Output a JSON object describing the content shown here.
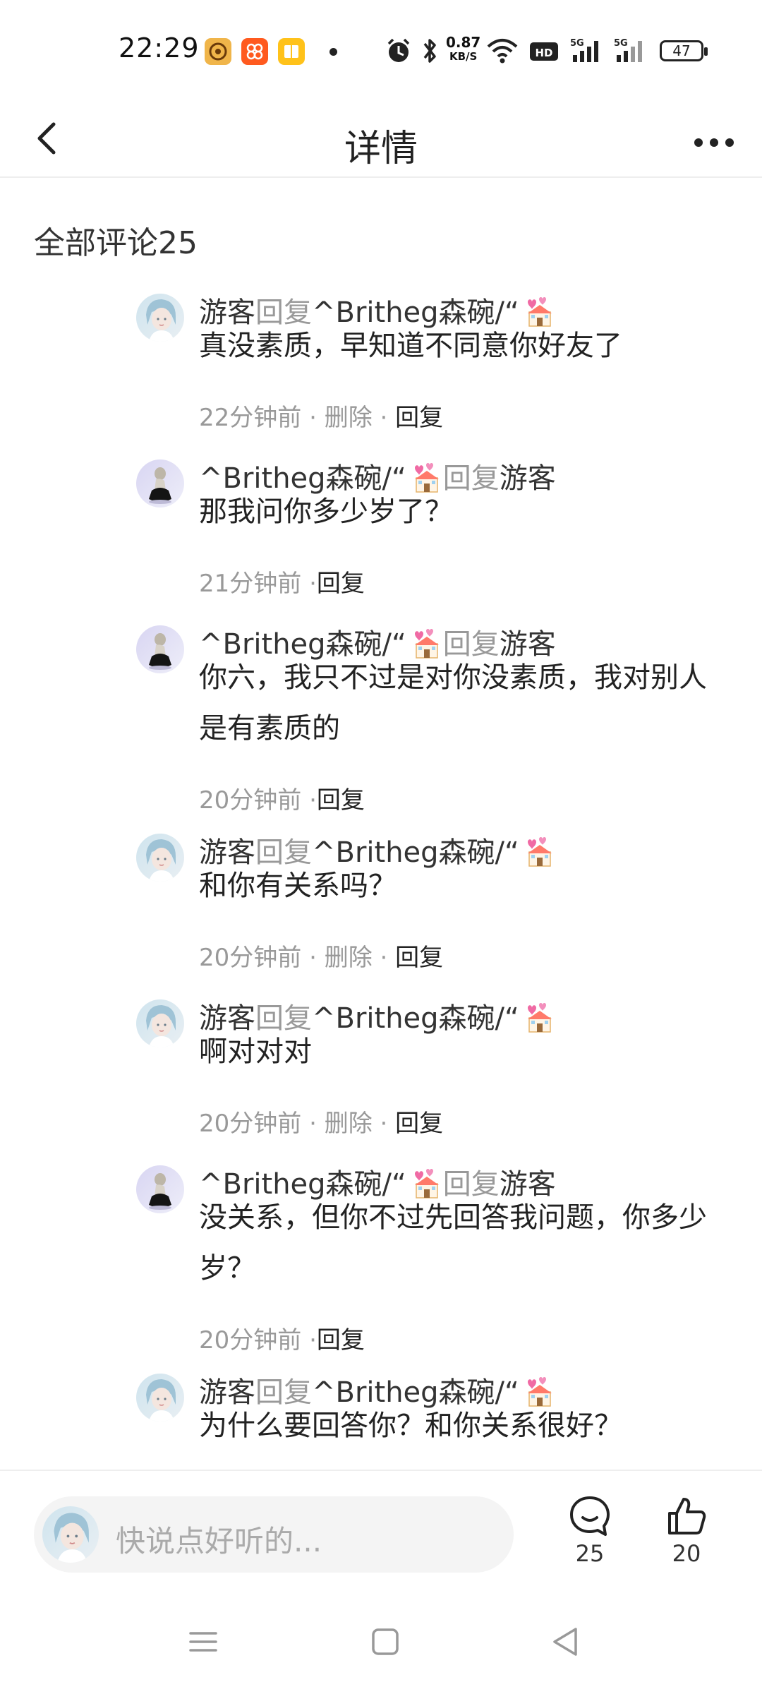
{
  "status_bar": {
    "time": "22:29",
    "net_speed_value": "0.87",
    "net_speed_unit": "KB/S",
    "battery": "47",
    "icons": [
      "app-icon-1",
      "app-icon-2",
      "app-icon-3",
      "alarm-icon",
      "bluetooth-icon",
      "wifi-icon",
      "hd-icon",
      "signal-5g-icon",
      "signal-5g-icon"
    ]
  },
  "header": {
    "title": "详情",
    "back_icon": "chevron-left-icon",
    "more_icon": "more-dots-icon"
  },
  "comments_section": {
    "title": "全部评论25"
  },
  "comments": [
    {
      "author": "游客",
      "reply_word": "回复",
      "target": "^Britheg森碗/“",
      "text": "真没素质，早知道不同意你好友了",
      "time": "22分钟前",
      "sep1": " · ",
      "delete": "删除",
      "sep2": " · ",
      "reply": "回复"
    },
    {
      "author": "^Britheg森碗/“",
      "reply_word": "回复",
      "target": "游客",
      "text": "那我问你多少岁了？",
      "time": "21分钟前",
      "sep2": " ·",
      "reply": "回复"
    },
    {
      "author": "^Britheg森碗/“",
      "reply_word": "回复",
      "target": "游客",
      "text": "你六，我只不过是对你没素质，我对别人是有素质的",
      "time": "20分钟前",
      "sep2": " ·",
      "reply": "回复"
    },
    {
      "author": "游客",
      "reply_word": "回复",
      "target": "^Britheg森碗/“",
      "text": "和你有关系吗？",
      "time": "20分钟前",
      "sep1": " · ",
      "delete": "删除",
      "sep2": " · ",
      "reply": "回复"
    },
    {
      "author": "游客",
      "reply_word": "回复",
      "target": "^Britheg森碗/“",
      "text": "啊对对对",
      "time": "20分钟前",
      "sep1": " · ",
      "delete": "删除",
      "sep2": " · ",
      "reply": "回复"
    },
    {
      "author": "^Britheg森碗/“",
      "reply_word": "回复",
      "target": "游客",
      "text": "没关系，但你不过先回答我问题，你多少岁？",
      "time": "20分钟前",
      "sep2": " ·",
      "reply": "回复"
    },
    {
      "author": "游客",
      "reply_word": "回复",
      "target": "^Britheg森碗/“",
      "text": "为什么要回答你？和你关系很好？"
    }
  ],
  "bottom_bar": {
    "input_placeholder": "快说点好听的...",
    "comment_count": "25",
    "like_count": "20"
  },
  "nav_bar": {
    "icons": [
      "menu-icon",
      "home-square-icon",
      "back-triangle-icon"
    ]
  },
  "colors": {
    "accent_gray": "#999999",
    "text": "#222222",
    "divider": "#eeeeee"
  }
}
